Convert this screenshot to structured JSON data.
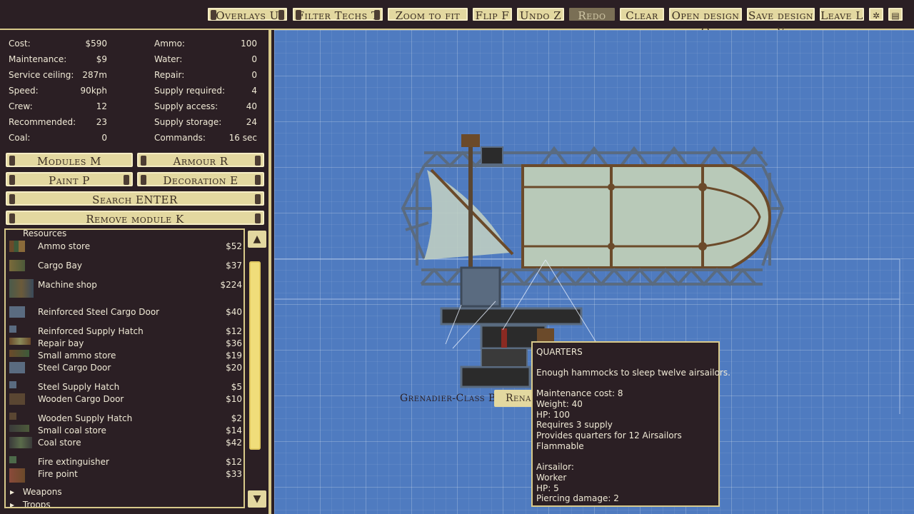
{
  "toolbar": {
    "overlays": "Overlays U",
    "filter_techs": "Filter Techs T",
    "zoom_to_fit": "Zoom to fit",
    "flip": "Flip F",
    "undo": "Undo Z",
    "redo": "Redo",
    "clear": "Clear",
    "open_design": "Open design O",
    "save_design": "Save design V",
    "leave": "Leave L",
    "gear_icon": "gear-icon",
    "book_icon": "book-icon"
  },
  "stats": {
    "cost": {
      "label": "Cost:",
      "value": "$590"
    },
    "maintenance": {
      "label": "Maintenance:",
      "value": "$9"
    },
    "service_ceiling": {
      "label": "Service ceiling:",
      "value": "287m"
    },
    "speed": {
      "label": "Speed:",
      "value": "90kph"
    },
    "crew": {
      "label": "Crew:",
      "value": "12"
    },
    "recommended": {
      "label": "Recommended:",
      "value": "23"
    },
    "coal": {
      "label": "Coal:",
      "value": "0"
    },
    "ammo": {
      "label": "Ammo:",
      "value": "100"
    },
    "water": {
      "label": "Water:",
      "value": "0"
    },
    "repair": {
      "label": "Repair:",
      "value": "0"
    },
    "supply_required": {
      "label": "Supply required:",
      "value": "4"
    },
    "supply_access": {
      "label": "Supply access:",
      "value": "40"
    },
    "supply_storage": {
      "label": "Supply storage:",
      "value": "24"
    },
    "commands": {
      "label": "Commands:",
      "value": "16 sec"
    }
  },
  "panel_buttons": {
    "modules": "Modules M",
    "armour": "Armour R",
    "paint": "Paint P",
    "decoration": "Decoration E",
    "search": "Search ENTER",
    "remove_module": "Remove module K"
  },
  "module_list": {
    "category_top": "Resources",
    "items": [
      {
        "name": "Ammo store",
        "price": "$52"
      },
      {
        "name": "Cargo Bay",
        "price": "$37"
      },
      {
        "name": "Machine shop",
        "price": "$224"
      },
      {
        "name": "Reinforced Steel Cargo Door",
        "price": "$40"
      },
      {
        "name": "Reinforced Supply Hatch",
        "price": "$12"
      },
      {
        "name": "Repair bay",
        "price": "$36"
      },
      {
        "name": "Small ammo store",
        "price": "$19"
      },
      {
        "name": "Steel Cargo Door",
        "price": "$20"
      },
      {
        "name": "Steel Supply Hatch",
        "price": "$5"
      },
      {
        "name": "Wooden Cargo Door",
        "price": "$10"
      },
      {
        "name": "Wooden Supply Hatch",
        "price": "$2"
      },
      {
        "name": "Small coal store",
        "price": "$14"
      },
      {
        "name": "Coal store",
        "price": "$42"
      },
      {
        "name": "Fire extinguisher",
        "price": "$12"
      },
      {
        "name": "Fire point",
        "price": "$33"
      }
    ],
    "category_weapons": "Weapons",
    "category_troops": "Troops"
  },
  "canvas": {
    "ship_name": "Grenadier-Class Bomber",
    "rename_label": "Rename"
  },
  "tooltip": {
    "title": "QUARTERS",
    "description": "Enough hammocks to sleep twelve airsailors.",
    "maintenance": "Maintenance cost: 8",
    "weight": "Weight: 40",
    "hp": "HP: 100",
    "requires": "Requires 3 supply",
    "provides": "Provides quarters for 12 Airsailors",
    "flammable": "Flammable",
    "crew_type": "Airsailor:",
    "crew_role": "Worker",
    "crew_hp": "HP: 5",
    "crew_damage": "Piercing damage: 2"
  },
  "colors": {
    "panel_bg": "#2b1f24",
    "button_bg": "#e3d8a0",
    "border_accent": "#d8c98a",
    "blueprint_bg": "#4f7bc0",
    "envelope": "#b8c9b8",
    "girder": "#5a6b80",
    "wood": "#6b4a2a"
  }
}
